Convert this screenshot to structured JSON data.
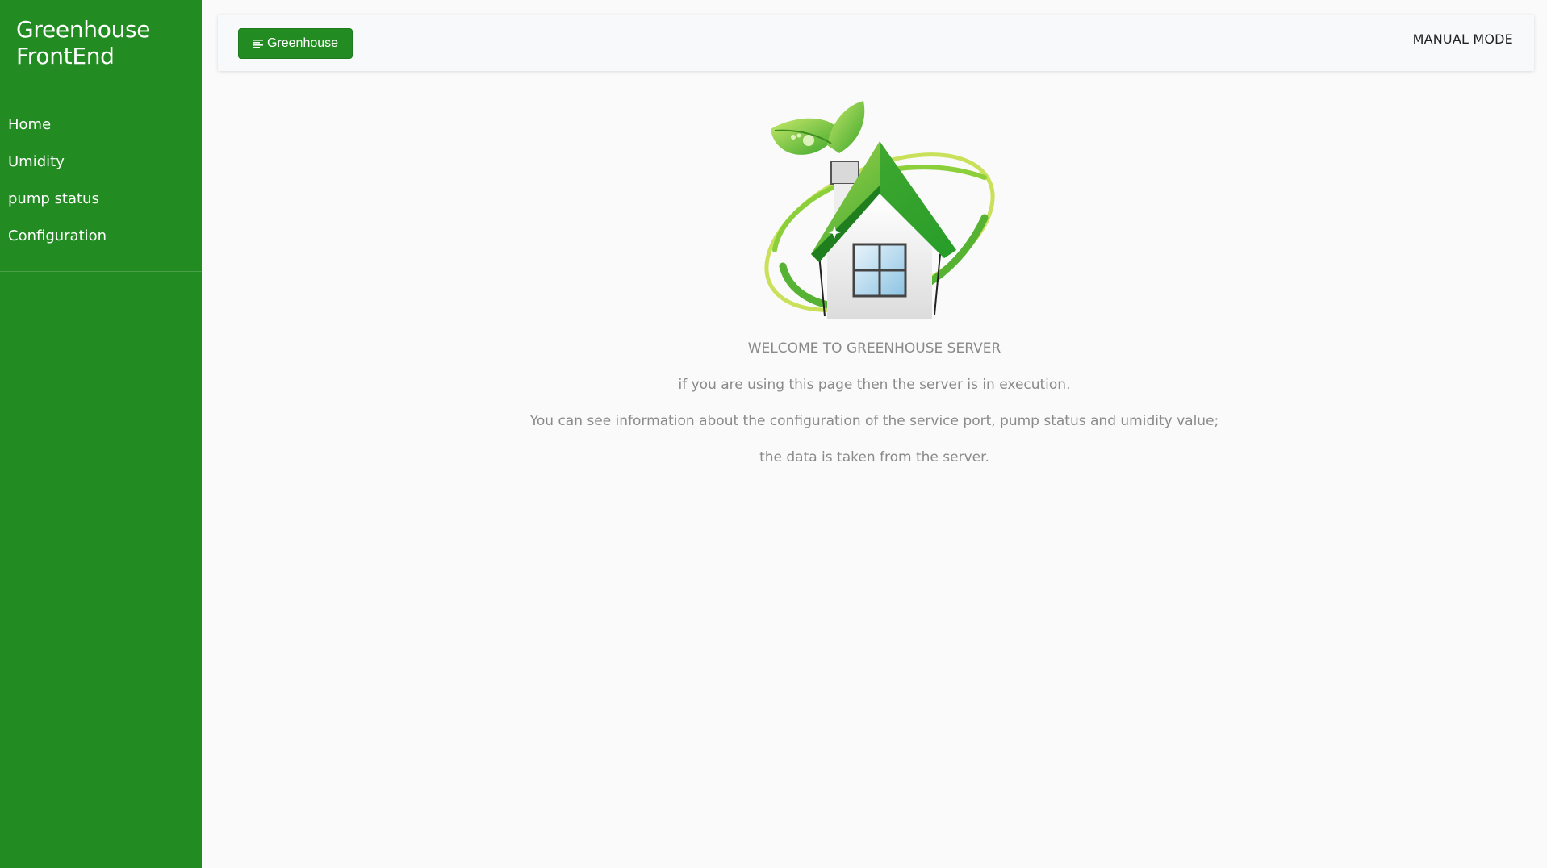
{
  "sidebar": {
    "brand_line1": "Greenhouse",
    "brand_line2": "FrontEnd",
    "items": [
      {
        "label": "Home"
      },
      {
        "label": "Umidity"
      },
      {
        "label": "pump status"
      },
      {
        "label": "Configuration"
      }
    ]
  },
  "topbar": {
    "toggle_label": "Greenhouse",
    "toggle_icon": "menu-align-left-icon",
    "mode_label": "MANUAL MODE"
  },
  "main": {
    "welcome": "WELCOME TO GREENHOUSE SERVER",
    "line1": "if you are using this page then the server is in execution.",
    "line2": "You can see information about the configuration of the service port, pump status and umidity value;",
    "line3": "the data is taken from the server."
  },
  "colors": {
    "brand_green": "#228b22",
    "page_bg": "#fafafa",
    "text_muted": "#8a8a8a"
  }
}
